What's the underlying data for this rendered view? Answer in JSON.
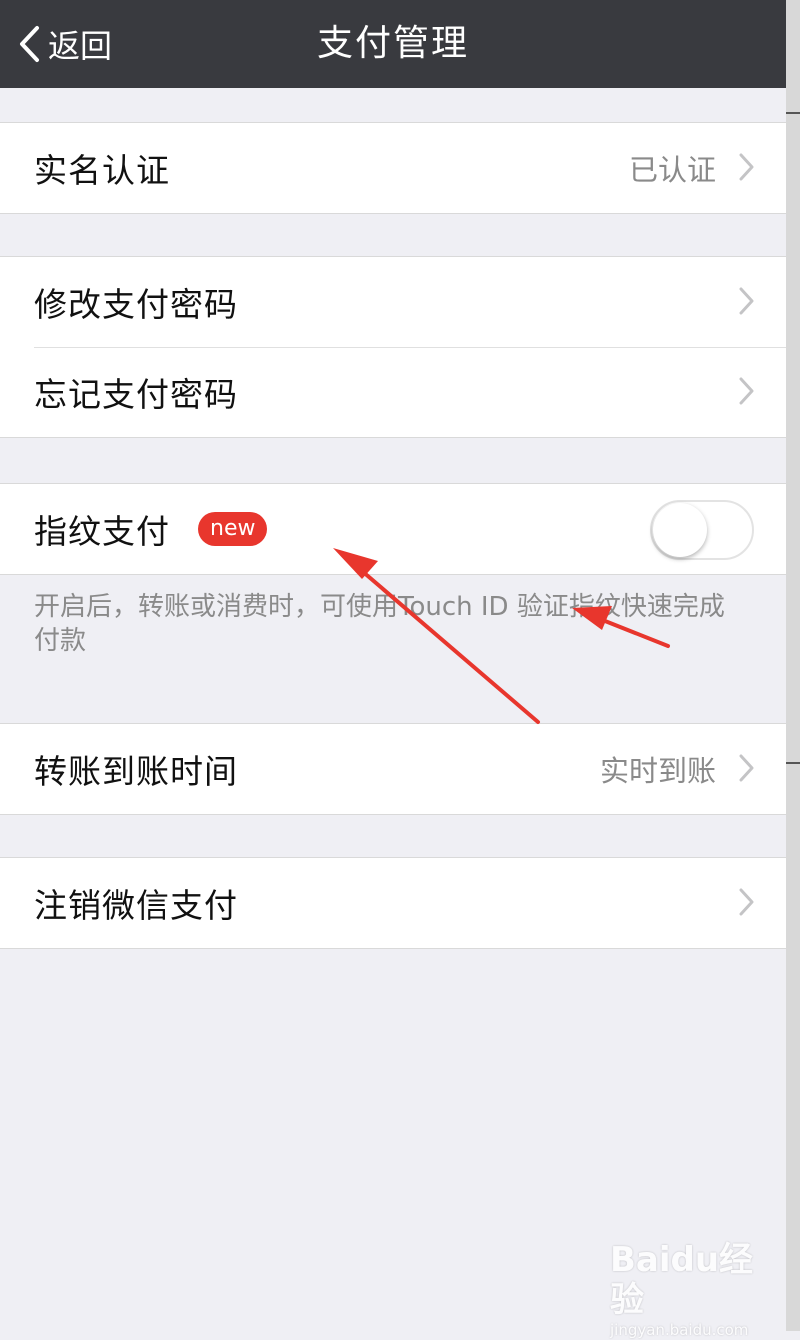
{
  "navbar": {
    "back_label": "返回",
    "title": "支付管理",
    "background": "#393a3f"
  },
  "sections": {
    "identity": {
      "label": "实名认证",
      "value": "已认证"
    },
    "password": {
      "change_label": "修改支付密码",
      "forgot_label": "忘记支付密码"
    },
    "fingerprint": {
      "label": "指纹支付",
      "badge": "new",
      "badge_color": "#e8362d",
      "toggle_on": false,
      "footnote": "开启后，转账或消费时，可使用Touch ID 验证指纹快速完成付款"
    },
    "transfer": {
      "label": "转账到账时间",
      "value": "实时到账"
    },
    "cancel": {
      "label": "注销微信支付"
    }
  },
  "annotation_color": "#e8362d",
  "watermark": {
    "logo": "Baidu经验",
    "url": "jingyan.baidu.com"
  },
  "icons": {
    "back": "chevron-left-icon",
    "disclosure": "chevron-right-icon"
  }
}
